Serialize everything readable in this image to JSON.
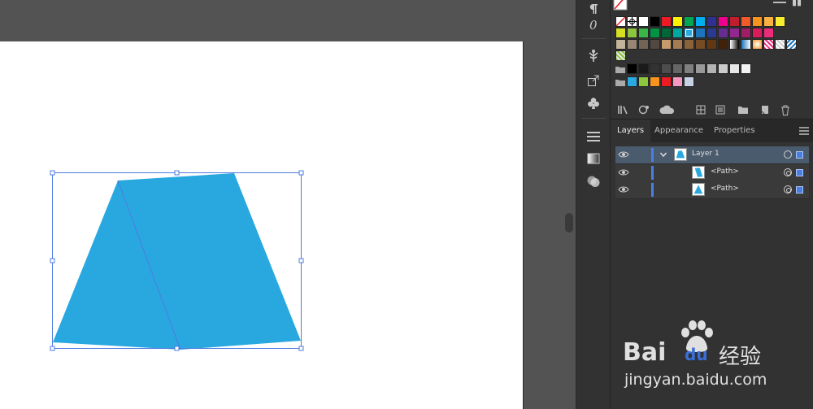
{
  "layers_panel": {
    "tabs": [
      "Layers",
      "Appearance",
      "Properties"
    ],
    "active_tab": "Layers",
    "rows": [
      {
        "label": "Layer 1",
        "selected": true
      },
      {
        "label": "<Path>",
        "selected": false
      },
      {
        "label": "<Path>",
        "selected": false
      }
    ]
  },
  "swatches": {
    "row1": [
      "#ffffff",
      "#000000",
      "#ed1c24",
      "#fff200",
      "#00a651",
      "#00aeef",
      "#2e3192",
      "#ec008c",
      "#be1e2d",
      "#f15a29",
      "#f7941d",
      "#fbb040",
      "#f9ed32"
    ],
    "row2": [
      "#d7df23",
      "#8dc63f",
      "#39b54a",
      "#009444",
      "#006838",
      "#00a79d",
      "#27aae1",
      "#1c75bc",
      "#2b3990",
      "#662d91",
      "#92278f",
      "#9e1f63",
      "#da1c5c",
      "#ee2a7b"
    ],
    "row3": [
      "#c2b59b",
      "#998675",
      "#736357",
      "#534741",
      "#c69c6d",
      "#a67c52",
      "#8c6239",
      "#754c24",
      "#603913",
      "#42210b"
    ],
    "gray_row": [
      "#000000",
      "#1a1a1a",
      "#333333",
      "#4d4d4d",
      "#666666",
      "#808080",
      "#999999",
      "#b3b3b3",
      "#cccccc",
      "#e6e6e6",
      "#f2f2f2"
    ],
    "color_group": [
      "#29abe2",
      "#8cc63f",
      "#f7931e",
      "#ed1c24",
      "#f49ac1",
      "#c7d3e5"
    ]
  },
  "artwork": {
    "fill_color": "#29a8e0"
  },
  "watermark": {
    "brand": "Bai",
    "brand_tail": "du",
    "chinese": "经验",
    "url": "jingyan.baidu.com"
  }
}
